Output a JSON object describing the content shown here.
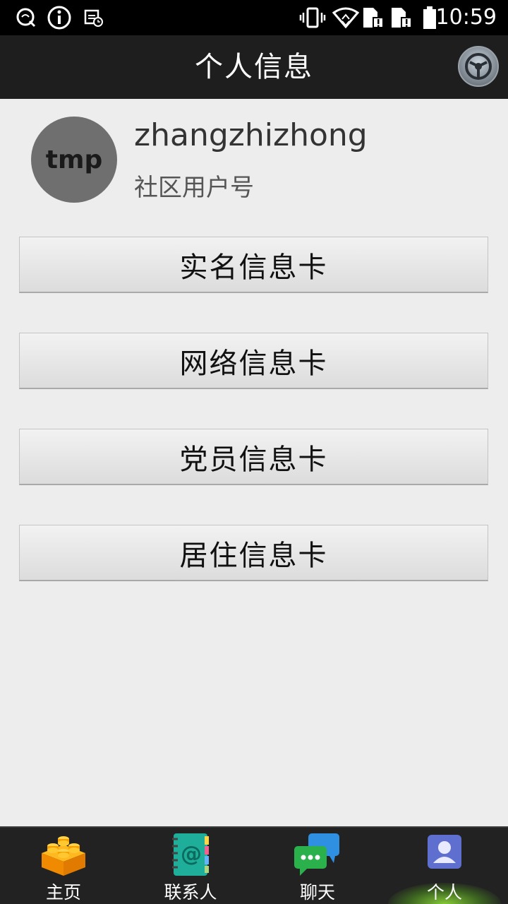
{
  "status_bar": {
    "time": "10:59",
    "icons": [
      "search-notification-icon",
      "info-icon",
      "calendar-clock-icon",
      "vibrate-icon",
      "wifi-icon",
      "sim1-icon",
      "sim2-icon",
      "battery-icon"
    ]
  },
  "app_bar": {
    "title": "个人信息",
    "settings_icon": "settings-wheel-icon"
  },
  "profile": {
    "avatar_text": "tmp",
    "username": "zhangzhizhong",
    "user_type": "社区用户号"
  },
  "cards": [
    {
      "label": "实名信息卡"
    },
    {
      "label": "网络信息卡"
    },
    {
      "label": "党员信息卡"
    },
    {
      "label": "居住信息卡"
    }
  ],
  "bottom_nav": {
    "active": "个人",
    "items": [
      {
        "label": "主页",
        "icon": "lego-brick-icon"
      },
      {
        "label": "联系人",
        "icon": "contacts-book-icon"
      },
      {
        "label": "聊天",
        "icon": "chat-bubbles-icon"
      },
      {
        "label": "个人",
        "icon": "person-icon"
      }
    ]
  },
  "colors": {
    "app_bar": "#1e1e1e",
    "background": "#ededed",
    "avatar": "#6f6f6f",
    "active_glow": "#96e63c"
  }
}
